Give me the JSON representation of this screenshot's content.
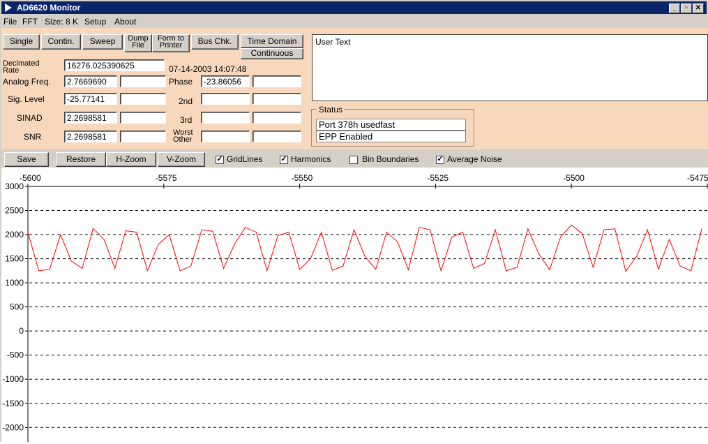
{
  "window": {
    "title": "AD6620 Monitor"
  },
  "menu": [
    "File",
    "FFT",
    "Size: 8 K",
    "Setup",
    "About"
  ],
  "buttons": {
    "single": "Single",
    "contin": "Contin.",
    "sweep": "Sweep",
    "dump_line1": "Dump",
    "dump_line2": "File",
    "form_line1": "Form to",
    "form_line2": "Printer",
    "bus_chk": "Bus Chk.",
    "time_domain": "Time Domain",
    "continuous": "Continuous"
  },
  "fields": {
    "decimated_rate_label": "Decimated Rate",
    "decimated_rate": "16276.025390625",
    "timestamp": "07-14-2003  14:07:48",
    "analog_freq_label": "Analog Freq.",
    "analog_freq": "2.7669690",
    "phase_label": "Phase",
    "phase": "-23.86056",
    "sig_level_label": "Sig. Level",
    "sig_level": "-25.77141",
    "second_label": "2nd",
    "sinad_label": "SINAD",
    "sinad": "2.2698581",
    "third_label": "3rd",
    "snr_label": "SNR",
    "snr": "2.2698581",
    "worst_other_label": "Worst Other"
  },
  "user_text": "User Text",
  "status": {
    "legend": "Status",
    "lines": [
      "Port 378h usedfast",
      "EPP Enabled"
    ]
  },
  "toolbar": {
    "save": "Save",
    "restore": "Restore",
    "hzoom": "H-Zoom",
    "vzoom": "V-Zoom",
    "options": [
      {
        "label": "GridLines",
        "checked": true
      },
      {
        "label": "Harmonics",
        "checked": true
      },
      {
        "label": "Bin Boundaries",
        "checked": false
      },
      {
        "label": "Average Noise",
        "checked": true
      }
    ]
  },
  "colors": {
    "trace": "#ff0000",
    "title_bar": "#0a246a",
    "panel": "#f8d8bc"
  },
  "chart_data": {
    "type": "line",
    "x_ticks": [
      "-5600",
      "-5575",
      "-5550",
      "-5525",
      "-5500",
      "-5475"
    ],
    "y_ticks": [
      "3000",
      "2500",
      "2000",
      "1500",
      "1000",
      "500",
      "0",
      "-500",
      "-1000",
      "-1500",
      "-2000"
    ],
    "xlim": [
      -5600,
      -5475
    ],
    "ylim": [
      -2300,
      3000
    ],
    "grid": true,
    "series": [
      {
        "x": [
          -5600,
          -5598,
          -5596,
          -5594,
          -5592,
          -5590,
          -5588,
          -5586,
          -5584,
          -5582,
          -5580,
          -5578,
          -5576,
          -5574,
          -5572,
          -5570,
          -5568,
          -5566,
          -5564,
          -5562,
          -5560,
          -5558,
          -5556,
          -5554,
          -5552,
          -5550,
          -5548,
          -5546,
          -5544,
          -5542,
          -5540,
          -5538,
          -5536,
          -5534,
          -5532,
          -5530,
          -5528,
          -5526,
          -5524,
          -5522,
          -5520,
          -5518,
          -5516,
          -5514,
          -5512,
          -5510,
          -5508,
          -5506,
          -5504,
          -5502,
          -5500,
          -5498,
          -5496,
          -5494,
          -5492,
          -5490,
          -5488,
          -5486,
          -5484,
          -5482,
          -5480,
          -5478,
          -5476
        ],
        "y": [
          2050,
          1250,
          1280,
          2000,
          1450,
          1300,
          2130,
          1900,
          1300,
          2080,
          2050,
          1250,
          1800,
          2000,
          1250,
          1350,
          2100,
          2070,
          1300,
          1800,
          2150,
          2050,
          1250,
          1980,
          2050,
          1280,
          1500,
          2050,
          1260,
          1350,
          2100,
          1550,
          1280,
          2050,
          1850,
          1270,
          2150,
          2100,
          1250,
          1950,
          2050,
          1300,
          1400,
          2100,
          1250,
          1320,
          2120,
          1600,
          1270,
          1950,
          2200,
          2020,
          1320,
          2100,
          2120,
          1240,
          1550,
          2100,
          1280,
          1900,
          1350,
          1250,
          2130
        ],
        "color": "#ff0000"
      }
    ]
  }
}
